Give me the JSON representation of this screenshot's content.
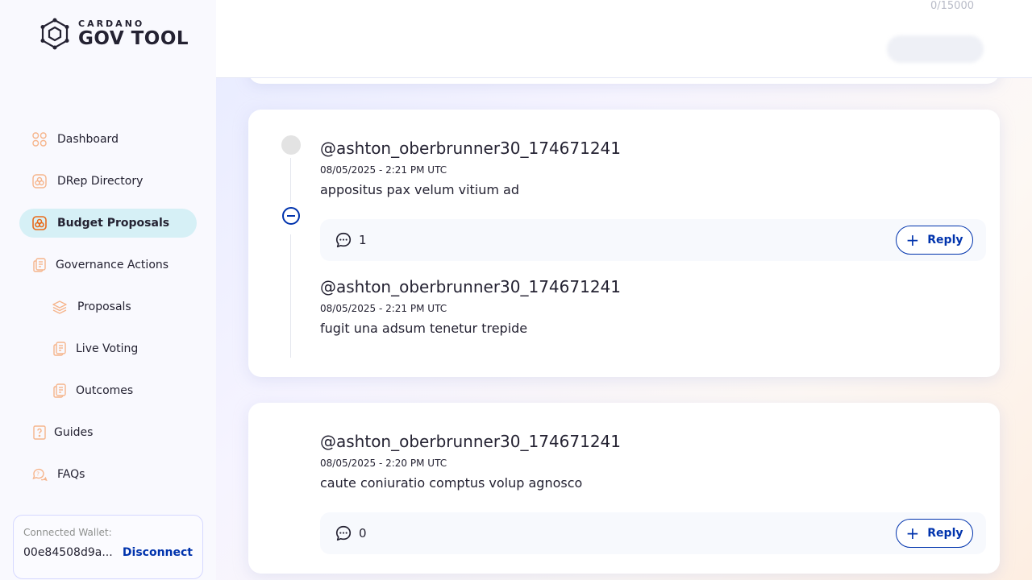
{
  "brand": {
    "small": "CARDANO",
    "big": "GOV TOOL"
  },
  "nav": [
    {
      "label": "Dashboard",
      "icon": "dashboard-icon",
      "active": false,
      "sub": false
    },
    {
      "label": "DRep Directory",
      "icon": "drep-directory-icon",
      "active": false,
      "sub": false
    },
    {
      "label": "Budget Proposals",
      "icon": "budget-proposals-icon",
      "active": true,
      "sub": false
    },
    {
      "label": "Governance Actions",
      "icon": "governance-actions-icon",
      "active": false,
      "sub": false
    },
    {
      "label": "Proposals",
      "icon": "proposals-icon",
      "active": false,
      "sub": true
    },
    {
      "label": "Live Voting",
      "icon": "live-voting-icon",
      "active": false,
      "sub": true
    },
    {
      "label": "Outcomes",
      "icon": "outcomes-icon",
      "active": false,
      "sub": true
    },
    {
      "label": "Guides",
      "icon": "guides-icon",
      "active": false,
      "sub": false
    },
    {
      "label": "FAQs",
      "icon": "faqs-icon",
      "active": false,
      "sub": false
    }
  ],
  "wallet": {
    "label": "Connected Wallet:",
    "address": "00e84508d9a...",
    "disconnect": "Disconnect"
  },
  "header": {
    "char_count": "0/15000"
  },
  "thread1": {
    "parent": {
      "author": "@ashton_oberbrunner30_174671241",
      "date": "08/05/2025 - 2:21 PM UTC",
      "text": "appositus pax velum vitium ad",
      "reply_count": "1",
      "reply_label": "Reply"
    },
    "child": {
      "author": "@ashton_oberbrunner30_174671241",
      "date": "08/05/2025 - 2:21 PM UTC",
      "text": "fugit una adsum tenetur trepide"
    }
  },
  "thread2": {
    "author": "@ashton_oberbrunner30_174671241",
    "date": "08/05/2025 - 2:20 PM UTC",
    "text": "caute coniuratio comptus volup agnosco",
    "reply_count": "0",
    "reply_label": "Reply"
  },
  "colors": {
    "accent": "#0033ad",
    "active_nav": "#d6f0f6",
    "icon_orange": "#f28c4b"
  }
}
